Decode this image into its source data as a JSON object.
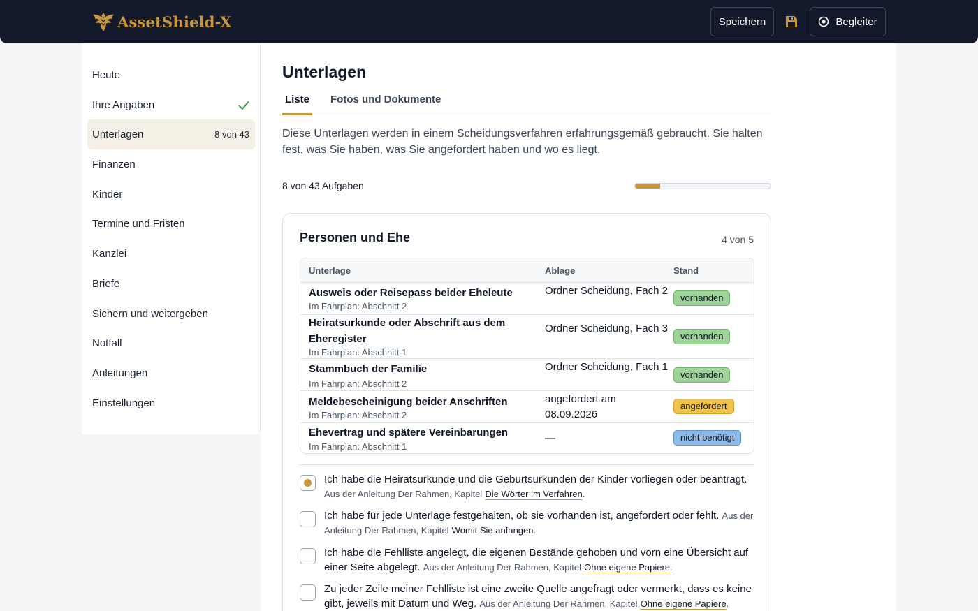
{
  "app": {
    "name": "AssetShield-X"
  },
  "topbar": {
    "save_label": "Speichern",
    "guide_label": "Begleiter",
    "logo_icon": "eagle-crest-icon",
    "disk_icon": "floppy-disk-icon",
    "guide_icon": "target-circle-icon"
  },
  "colors": {
    "accent": "#c8963f",
    "topbar": "#121a2b",
    "active_nav": "#f5f0e6"
  },
  "sidebar": {
    "items": [
      {
        "label": "Heute"
      },
      {
        "label": "Ihre Angaben",
        "icon": "checkmark-icon"
      },
      {
        "label": "Unterlagen",
        "count": "8 von 43",
        "active": true
      },
      {
        "label": "Finanzen"
      },
      {
        "label": "Kinder"
      },
      {
        "label": "Termine und Fristen"
      },
      {
        "label": "Kanzlei"
      },
      {
        "label": "Briefe"
      },
      {
        "label": "Sichern und weitergeben"
      },
      {
        "label": "Notfall"
      },
      {
        "label": "Anleitungen"
      },
      {
        "label": "Einstellungen"
      }
    ]
  },
  "main": {
    "title": "Unterlagen",
    "tabs": [
      {
        "label": "Liste",
        "active": true
      },
      {
        "label": "Fotos und Dokumente"
      }
    ],
    "intro": "Diese Unterlagen werden in einem Scheidungsverfahren erfahrungsgemäß gebraucht. Sie halten fest, was Sie haben, was Sie angefordert haben und wo es liegt.",
    "progress": {
      "label": "8 von 43 Aufgaben",
      "done": 8,
      "total": 43
    }
  },
  "section": {
    "title": "Personen und Ehe",
    "count": "4 von 5",
    "columns": [
      "Unterlage",
      "Ablage",
      "Stand"
    ],
    "rows": [
      {
        "name": "Ausweis oder Reisepass beider Eheleute",
        "meta": "Im Fahrplan: Abschnitt 2",
        "place": "Ordner Scheidung, Fach 2",
        "status": "vorhanden"
      },
      {
        "name": "Heiratsurkunde oder Abschrift aus dem Eheregister",
        "meta": "Im Fahrplan: Abschnitt 1",
        "place": "Ordner Scheidung, Fach 3",
        "status": "vorhanden"
      },
      {
        "name": "Stammbuch der Familie",
        "meta": "Im Fahrplan: Abschnitt 2",
        "place": "Ordner Scheidung, Fach 1",
        "status": "vorhanden"
      },
      {
        "name": "Meldebescheinigung beider Anschriften",
        "meta": "Im Fahrplan: Abschnitt 2",
        "place": "angefordert am 08.09.2026",
        "status": "angefordert"
      },
      {
        "name": "Ehevertrag und spätere Vereinbarungen",
        "meta": "Im Fahrplan: Abschnitt 1",
        "place": "—",
        "status": "nicht benötigt"
      }
    ],
    "checklist": [
      {
        "checked": true,
        "text": "Ich habe die Heiratsurkunde und die Geburtsurkunden der Kinder vorliegen oder beantragt.",
        "source": "Aus der Anleitung Der Rahmen, Kapitel",
        "chapter": "Die Wörter im Verfahren"
      },
      {
        "checked": false,
        "text": "Ich habe für jede Unterlage festgehalten, ob sie vorhanden ist, angefordert oder fehlt.",
        "source": "Aus der Anleitung Der Rahmen, Kapitel",
        "chapter": "Womit Sie anfangen"
      },
      {
        "checked": false,
        "text": "Ich habe die Fehlliste angelegt, die eigenen Bestände gehoben und vorn eine Übersicht auf einer Seite abgelegt.",
        "source": "Aus der Anleitung Der Rahmen, Kapitel",
        "chapter": "Ohne eigene Papiere"
      },
      {
        "checked": false,
        "text": "Zu jeder Zeile meiner Fehlliste ist eine zweite Quelle angefragt oder vermerkt, dass es keine gibt, jeweils mit Datum und Weg.",
        "source": "Aus der Anleitung Der Rahmen, Kapitel",
        "chapter": "Ohne eigene Papiere"
      }
    ]
  }
}
